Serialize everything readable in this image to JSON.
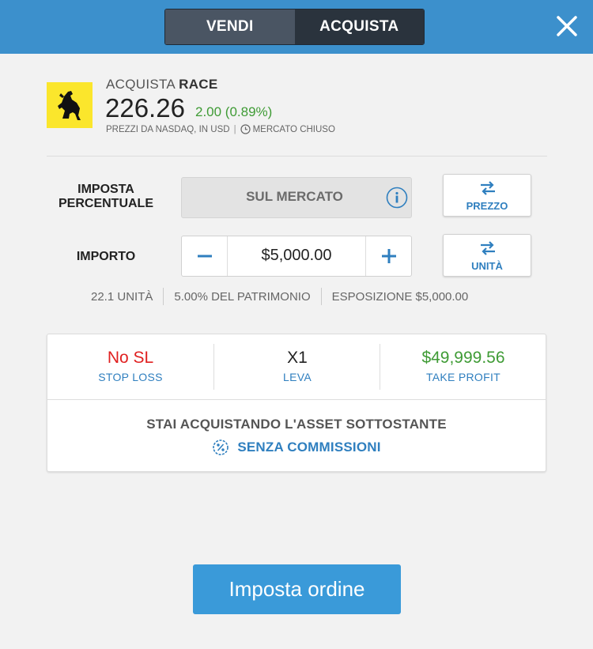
{
  "header": {
    "sell_label": "VENDI",
    "buy_label": "ACQUISTA",
    "close_icon": "close-icon"
  },
  "asset": {
    "action_label": "ACQUISTA",
    "symbol": "RACE",
    "price": "226.26",
    "change": "2.00 (0.89%)",
    "source": "PREZZI DA NASDAQ, IN USD",
    "market_status": "MERCATO CHIUSO",
    "logo_icon": "ferrari-horse-logo"
  },
  "order": {
    "rate_label": "IMPOSTA PERCENTUALE",
    "rate_value": "SUL MERCATO",
    "price_toggle_label": "PREZZO",
    "amount_label": "IMPORTO",
    "amount_value": "$5,000.00",
    "units_toggle_label": "UNITÀ",
    "units": "22.1 UNITÀ",
    "equity_pct": "5.00% DEL PATRIMONIO",
    "exposure": "ESPOSIZIONE $5,000.00"
  },
  "risk": {
    "stop_loss_value": "No SL",
    "stop_loss_label": "STOP LOSS",
    "leverage_value": "X1",
    "leverage_label": "LEVA",
    "take_profit_value": "$49,999.56",
    "take_profit_label": "TAKE PROFIT"
  },
  "notice": {
    "message": "STAI ACQUISTANDO L'ASSET SOTTOSTANTE",
    "no_fee_label": "SENZA COMMISSIONI"
  },
  "submit_label": "Imposta ordine",
  "colors": {
    "header_blue": "#3c90cc",
    "accent_blue": "#2f7fbf",
    "positive_green": "#3f9b35",
    "negative_red": "#e02020",
    "button_blue": "#3a9ad9"
  }
}
